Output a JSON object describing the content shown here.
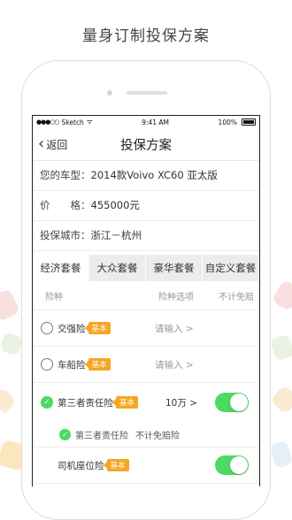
{
  "headline": "量身订制投保方案",
  "status_bar": {
    "carrier": "Sketch",
    "time": "9:41 AM",
    "battery": "100%"
  },
  "nav": {
    "back_label": "返回",
    "title": "投保方案"
  },
  "info": {
    "car_label": "您的车型：",
    "car_value": "2014款Voivo XC60 亚太版",
    "price_label": "价　　格：",
    "price_value": "455000元",
    "city_label": "投保城市：",
    "city_value": "浙江－杭州"
  },
  "tabs": [
    "经济套餐",
    "大众套餐",
    "豪华套餐",
    "自定义套餐"
  ],
  "columns": {
    "type": "险种",
    "option": "险种选项",
    "deductible": "不计免赔"
  },
  "rows": [
    {
      "name": "交强险",
      "badge": "基本",
      "option": "请输入 >"
    },
    {
      "name": "车船险",
      "badge": "基本",
      "option": "请输入 >"
    },
    {
      "name": "第三者责任险",
      "badge": "基本",
      "option": "10万 >"
    },
    {
      "name": "司机座位险",
      "badge": "基本"
    }
  ],
  "sub_row": {
    "name": "第三者责任险",
    "extra": "不计免赔险"
  },
  "accent_color": "#4cd964",
  "badge_color": "#f5a623"
}
